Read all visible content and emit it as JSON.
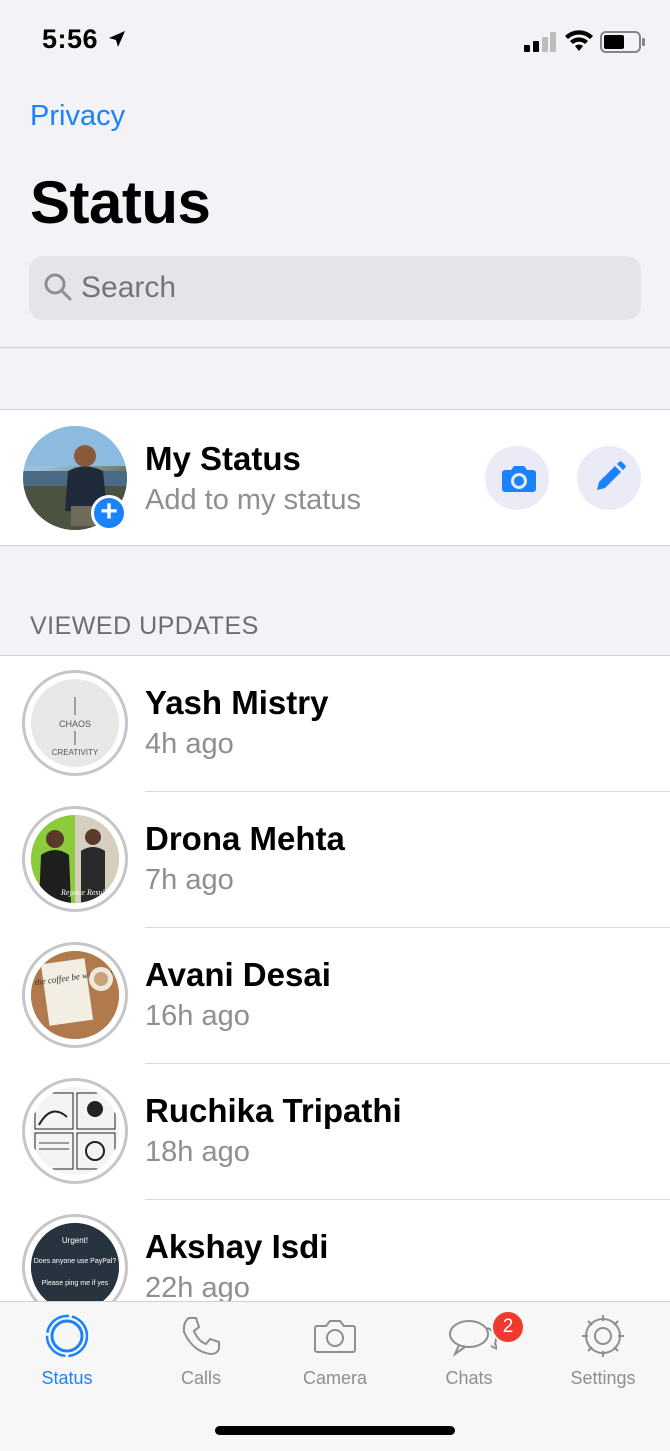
{
  "status_bar": {
    "time": "5:56"
  },
  "header": {
    "privacy_link": "Privacy",
    "title": "Status"
  },
  "search": {
    "placeholder": "Search"
  },
  "my_status": {
    "name": "My Status",
    "subtitle": "Add to my status"
  },
  "viewed_section": {
    "label": "VIEWED UPDATES"
  },
  "updates": [
    {
      "name": "Yash Mistry",
      "time": "4h ago"
    },
    {
      "name": "Drona Mehta",
      "time": "7h ago"
    },
    {
      "name": "Avani Desai",
      "time": "16h ago"
    },
    {
      "name": "Ruchika Tripathi",
      "time": "18h ago"
    },
    {
      "name": "Akshay Isdi",
      "time": "22h ago"
    }
  ],
  "thumbnails": {
    "yash": [
      "CHAOS",
      "CREATIVITY"
    ],
    "drona": "Rejoice Result",
    "avani": "may the coffee be with you",
    "akshay": [
      "Urgent!",
      "Does anyone use PayPal?",
      "Please ping me if yes"
    ]
  },
  "tabbar": {
    "tabs": [
      {
        "label": "Status",
        "icon": "status-ring-icon",
        "active": true
      },
      {
        "label": "Calls",
        "icon": "phone-icon"
      },
      {
        "label": "Camera",
        "icon": "camera-icon"
      },
      {
        "label": "Chats",
        "icon": "chat-bubbles-icon",
        "badge": "2"
      },
      {
        "label": "Settings",
        "icon": "gear-icon"
      }
    ]
  },
  "colors": {
    "accent": "#1a82fb",
    "badge": "#f03a2e",
    "secondary_text": "#8e8e93"
  }
}
